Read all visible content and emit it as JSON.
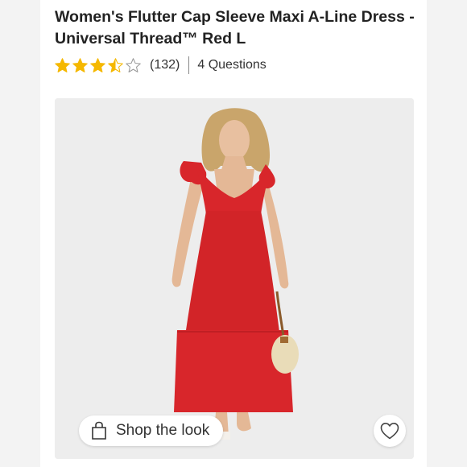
{
  "product": {
    "title": "Women's Flutter Cap Sleeve Maxi A-Line Dress - Universal Thread™ Red L"
  },
  "rating": {
    "value": 3.5,
    "max": 5,
    "count_label": "(132)",
    "questions_label": "4 Questions",
    "star_color": "#f5b800"
  },
  "image": {
    "alt": "Model wearing red flutter sleeve maxi dress",
    "shop_the_look_label": "Shop the look",
    "favorite_icon": "heart-icon",
    "bag_icon": "shopping-bag-icon",
    "dress_color": "#d8262b"
  }
}
